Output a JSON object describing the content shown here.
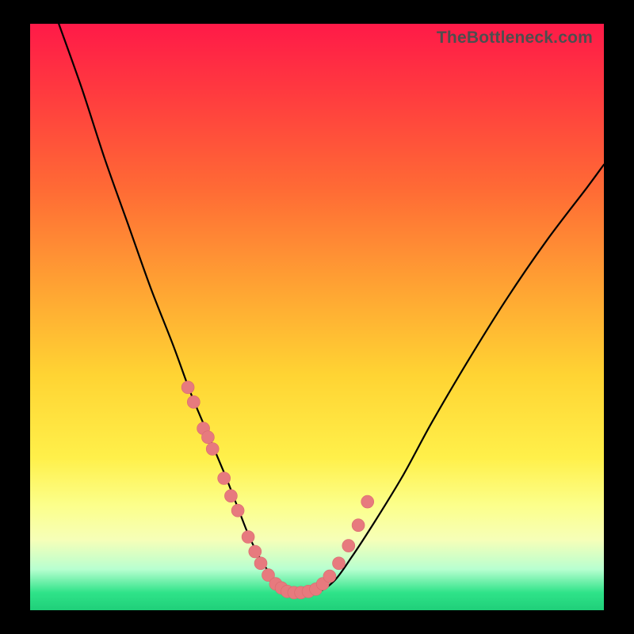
{
  "attribution": "TheBottleneck.com",
  "colors": {
    "frame": "#000000",
    "gradient_top": "#ff1a48",
    "gradient_bottom": "#1fcf79",
    "curve": "#000000",
    "marker_fill": "#e77a7e",
    "marker_stroke": "#d96a6e"
  },
  "chart_data": {
    "type": "line",
    "title": "",
    "xlabel": "",
    "ylabel": "",
    "xlim": [
      0,
      100
    ],
    "ylim": [
      0,
      100
    ],
    "grid": false,
    "series": [
      {
        "name": "bottleneck-curve",
        "x": [
          5,
          9,
          13,
          17,
          21,
          25,
          28,
          31,
          34,
          36,
          38,
          40,
          42,
          44,
          46,
          48,
          50,
          53,
          56,
          60,
          65,
          70,
          76,
          83,
          90,
          97,
          100
        ],
        "y": [
          100,
          89,
          77,
          66,
          55,
          45,
          37,
          30,
          23,
          18,
          13,
          9,
          6,
          4,
          3,
          3,
          3,
          5,
          9,
          15,
          23,
          32,
          42,
          53,
          63,
          72,
          76
        ]
      }
    ],
    "markers": {
      "name": "highlight-points",
      "x": [
        27.5,
        28.5,
        30.2,
        31.0,
        31.8,
        33.8,
        35.0,
        36.2,
        38.0,
        39.2,
        40.2,
        41.5,
        42.8,
        43.8,
        44.8,
        46.0,
        47.2,
        48.5,
        49.8,
        51.0,
        52.2,
        53.8,
        55.5,
        57.2,
        58.8
      ],
      "y": [
        38.0,
        35.5,
        31.0,
        29.5,
        27.5,
        22.5,
        19.5,
        17.0,
        12.5,
        10.0,
        8.0,
        6.0,
        4.5,
        3.8,
        3.2,
        3.0,
        3.0,
        3.2,
        3.6,
        4.5,
        5.8,
        8.0,
        11.0,
        14.5,
        18.5
      ],
      "r": 8
    }
  }
}
